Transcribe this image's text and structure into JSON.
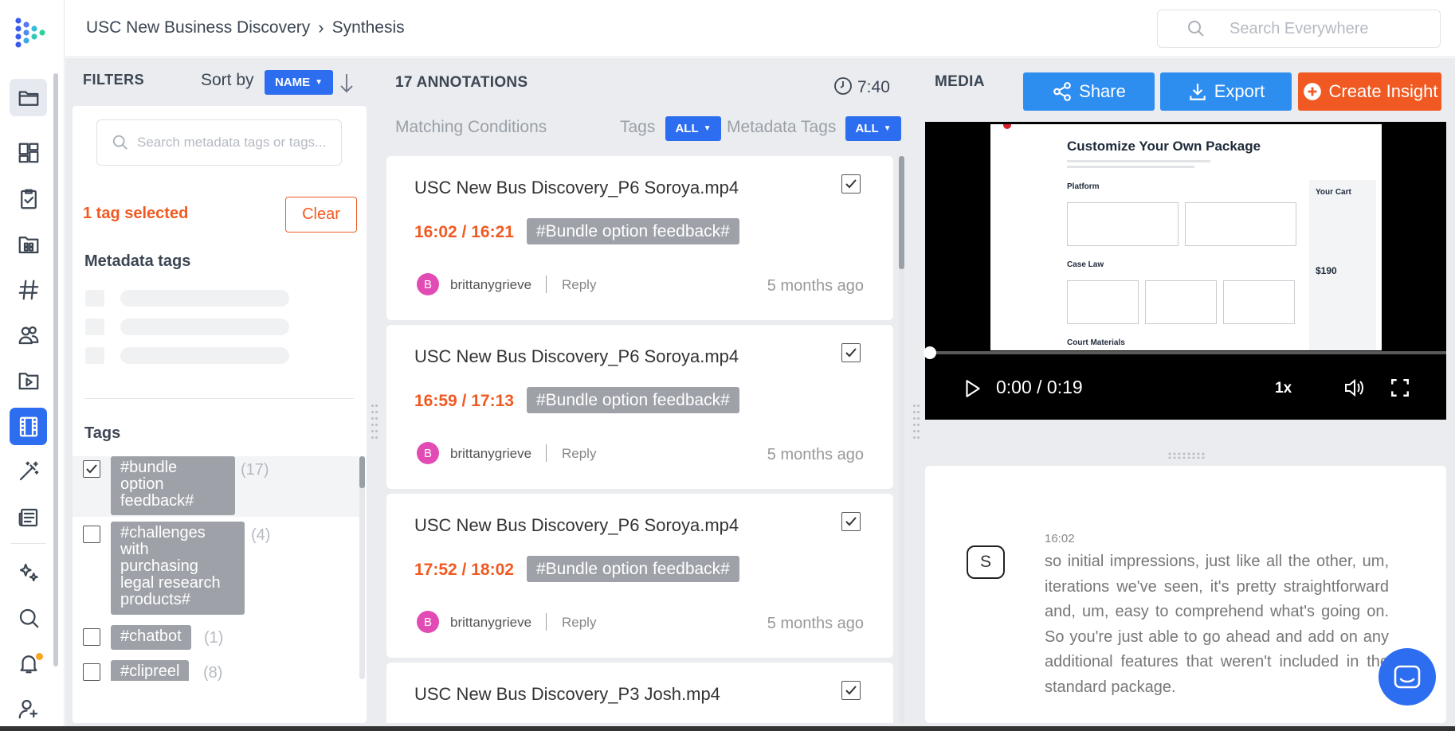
{
  "breadcrumb": {
    "project": "USC New Business Discovery",
    "page": "Synthesis"
  },
  "search": {
    "placeholder": "Search Everywhere"
  },
  "filters": {
    "heading": "FILTERS",
    "sort_label": "Sort by",
    "sort_value": "NAME",
    "search_placeholder": "Search metadata tags or tags...",
    "selected_text": "1 tag selected",
    "clear_label": "Clear",
    "metadata_heading": "Metadata tags",
    "tags_heading": "Tags",
    "tags": [
      {
        "label": "#bundle\noption\nfeedback#",
        "count": "(17)",
        "checked": true
      },
      {
        "label": "#challenges\nwith\npurchasing\nlegal research\nproducts#",
        "count": "(4)",
        "checked": false
      },
      {
        "label": "#chatbot",
        "count": "(1)",
        "checked": false
      },
      {
        "label": "#clipreel",
        "count": "(8)",
        "checked": false
      }
    ]
  },
  "annotations": {
    "heading": "17 ANNOTATIONS",
    "duration": "7:40",
    "matching_label": "Matching Conditions",
    "tags_label": "Tags",
    "tags_value": "ALL",
    "meta_label": "Metadata Tags",
    "meta_value": "ALL",
    "cards": [
      {
        "title": "USC New Bus Discovery_P6 Soroya.mp4",
        "time": "16:02 / 16:21",
        "tag": "#Bundle option feedback#",
        "avatar": "B",
        "user": "brittanygrieve",
        "reply": "Reply",
        "ago": "5 months ago"
      },
      {
        "title": "USC New Bus Discovery_P6 Soroya.mp4",
        "time": "16:59 / 17:13",
        "tag": "#Bundle option feedback#",
        "avatar": "B",
        "user": "brittanygrieve",
        "reply": "Reply",
        "ago": "5 months ago"
      },
      {
        "title": "USC New Bus Discovery_P6 Soroya.mp4",
        "time": "17:52 / 18:02",
        "tag": "#Bundle option feedback#",
        "avatar": "B",
        "user": "brittanygrieve",
        "reply": "Reply",
        "ago": "5 months ago"
      },
      {
        "title": "USC New Bus Discovery_P3 Josh.mp4"
      }
    ]
  },
  "media": {
    "heading": "MEDIA",
    "share_label": "Share",
    "export_label": "Export",
    "insight_label": "Create Insight",
    "video": {
      "page_title": "Customize Your Own Package",
      "sections": [
        "Platform",
        "Case Law",
        "Court Materials"
      ],
      "cart_title": "Your Cart",
      "cart_price": "$190",
      "time": "0:00 / 0:19",
      "speed": "1x",
      "progress": 0
    },
    "transcript": {
      "speaker": "S",
      "timestamp": "16:02",
      "text": "so initial impressions, just like all the other, um, iterations we've seen, it's pretty straightforward and, um, easy to comprehend what's going on. So you're just able to go ahead and add on any additional features that weren't included in the standard package."
    }
  },
  "colors": {
    "accent": "#2d6df0",
    "orange": "#f05a22",
    "tag_gray": "#9ea2a8",
    "panel": "#eaecef"
  },
  "icons": [
    "logo-icon",
    "folder-icon",
    "dashboard-icon",
    "clipboard-check-icon",
    "grid-folder-icon",
    "hashtag-icon",
    "people-icon",
    "video-play-icon",
    "film-icon",
    "magic-wand-icon",
    "newspaper-icon",
    "sparkles-icon",
    "search-icon",
    "bell-icon",
    "add-user-icon"
  ]
}
